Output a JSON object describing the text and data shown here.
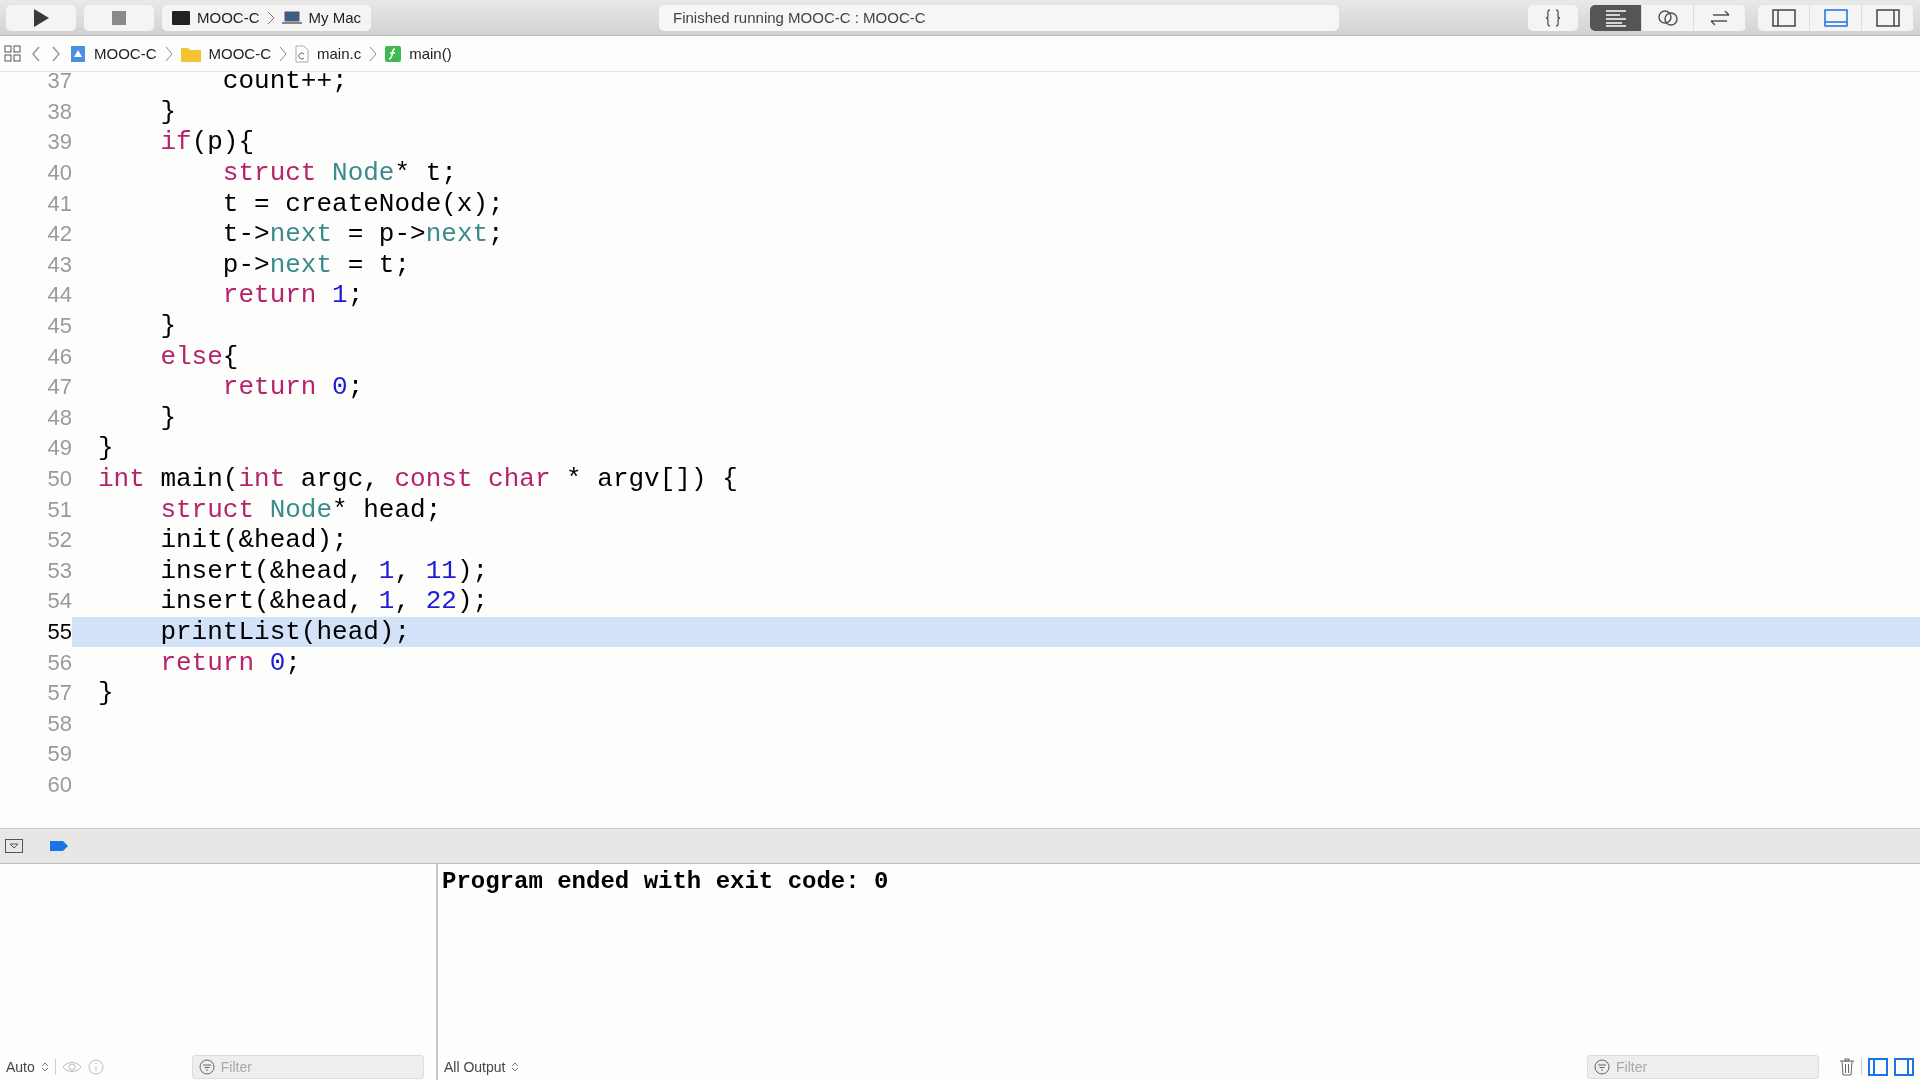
{
  "toolbar": {
    "scheme": "MOOC-C",
    "destination": "My Mac",
    "status": "Finished running MOOC-C : MOOC-C",
    "editor_modes": [
      {
        "kind": "standard",
        "selected": true
      },
      {
        "kind": "assistant",
        "selected": false
      },
      {
        "kind": "version",
        "selected": false
      }
    ],
    "panels": [
      {
        "kind": "navigator",
        "selected": false
      },
      {
        "kind": "debug",
        "selected": true
      },
      {
        "kind": "utilities",
        "selected": false
      }
    ]
  },
  "breadcrumb": [
    {
      "kind": "project",
      "label": "MOOC-C"
    },
    {
      "kind": "folder",
      "label": "MOOC-C"
    },
    {
      "kind": "file",
      "label": "main.c"
    },
    {
      "kind": "function",
      "label": "main()"
    }
  ],
  "editor": {
    "lines": [
      {
        "number": "37",
        "selected": false,
        "tokens": [
          {
            "text": "        count++;",
            "kind": "plain"
          }
        ]
      },
      {
        "number": "38",
        "selected": false,
        "tokens": [
          {
            "text": "    }",
            "kind": "plain"
          }
        ]
      },
      {
        "number": "39",
        "selected": false,
        "tokens": [
          {
            "text": "    if",
            "kind": "keyword"
          },
          {
            "text": "(p){",
            "kind": "plain"
          }
        ]
      },
      {
        "number": "40",
        "selected": false,
        "tokens": [
          {
            "text": "        struct",
            "kind": "keyword"
          },
          {
            "text": " Node",
            "kind": "type"
          },
          {
            "text": "* t;",
            "kind": "plain"
          }
        ]
      },
      {
        "number": "41",
        "selected": false,
        "tokens": [
          {
            "text": "        t = createNode(x);",
            "kind": "plain"
          }
        ]
      },
      {
        "number": "42",
        "selected": false,
        "tokens": [
          {
            "text": "        t->",
            "kind": "plain"
          },
          {
            "text": "next",
            "kind": "type"
          },
          {
            "text": " = p->",
            "kind": "plain"
          },
          {
            "text": "next",
            "kind": "type"
          },
          {
            "text": ";",
            "kind": "plain"
          }
        ]
      },
      {
        "number": "43",
        "selected": false,
        "tokens": [
          {
            "text": "        p->",
            "kind": "plain"
          },
          {
            "text": "next",
            "kind": "type"
          },
          {
            "text": " = t;",
            "kind": "plain"
          }
        ]
      },
      {
        "number": "44",
        "selected": false,
        "tokens": [
          {
            "text": "        return",
            "kind": "keyword"
          },
          {
            "text": " 1",
            "kind": "number"
          },
          {
            "text": ";",
            "kind": "plain"
          }
        ]
      },
      {
        "number": "45",
        "selected": false,
        "tokens": [
          {
            "text": "    }",
            "kind": "plain"
          }
        ]
      },
      {
        "number": "46",
        "selected": false,
        "tokens": [
          {
            "text": "    else",
            "kind": "keyword"
          },
          {
            "text": "{",
            "kind": "plain"
          }
        ]
      },
      {
        "number": "47",
        "selected": false,
        "tokens": [
          {
            "text": "        return",
            "kind": "keyword"
          },
          {
            "text": " 0",
            "kind": "number"
          },
          {
            "text": ";",
            "kind": "plain"
          }
        ]
      },
      {
        "number": "48",
        "selected": false,
        "tokens": [
          {
            "text": "    }",
            "kind": "plain"
          }
        ]
      },
      {
        "number": "49",
        "selected": false,
        "tokens": [
          {
            "text": "}",
            "kind": "plain"
          }
        ]
      },
      {
        "number": "50",
        "selected": false,
        "tokens": [
          {
            "text": "int",
            "kind": "keyword"
          },
          {
            "text": " main(",
            "kind": "plain"
          },
          {
            "text": "int",
            "kind": "keyword"
          },
          {
            "text": " argc, ",
            "kind": "plain"
          },
          {
            "text": "const",
            "kind": "keyword"
          },
          {
            "text": " char",
            "kind": "keyword"
          },
          {
            "text": " * argv[]) {",
            "kind": "plain"
          }
        ]
      },
      {
        "number": "51",
        "selected": false,
        "tokens": [
          {
            "text": "    struct",
            "kind": "keyword"
          },
          {
            "text": " Node",
            "kind": "type"
          },
          {
            "text": "* head;",
            "kind": "plain"
          }
        ]
      },
      {
        "number": "52",
        "selected": false,
        "tokens": [
          {
            "text": "    init(&head);",
            "kind": "plain"
          }
        ]
      },
      {
        "number": "53",
        "selected": false,
        "tokens": [
          {
            "text": "    insert(&head, ",
            "kind": "plain"
          },
          {
            "text": "1",
            "kind": "number"
          },
          {
            "text": ", ",
            "kind": "plain"
          },
          {
            "text": "11",
            "kind": "number"
          },
          {
            "text": ");",
            "kind": "plain"
          }
        ]
      },
      {
        "number": "54",
        "selected": false,
        "tokens": [
          {
            "text": "    insert(&head, ",
            "kind": "plain"
          },
          {
            "text": "1",
            "kind": "number"
          },
          {
            "text": ", ",
            "kind": "plain"
          },
          {
            "text": "22",
            "kind": "number"
          },
          {
            "text": ");",
            "kind": "plain"
          }
        ]
      },
      {
        "number": "55",
        "selected": true,
        "tokens": [
          {
            "text": "    printList(head);",
            "kind": "plain"
          }
        ]
      },
      {
        "number": "56",
        "selected": false,
        "tokens": [
          {
            "text": "    return",
            "kind": "keyword"
          },
          {
            "text": " 0",
            "kind": "number"
          },
          {
            "text": ";",
            "kind": "plain"
          }
        ]
      },
      {
        "number": "57",
        "selected": false,
        "tokens": [
          {
            "text": "}",
            "kind": "plain"
          }
        ]
      },
      {
        "number": "58",
        "selected": false
      },
      {
        "number": "59",
        "selected": false
      },
      {
        "number": "60",
        "selected": false
      }
    ]
  },
  "debug_bar": {
    "breakpoints_active": true
  },
  "console": {
    "output": "Program ended with exit code: 0",
    "variables_scope": "Auto",
    "left_filter": {
      "placeholder": "Filter"
    },
    "output_scope": "All Output",
    "right_filter": {
      "placeholder": "Filter"
    }
  }
}
